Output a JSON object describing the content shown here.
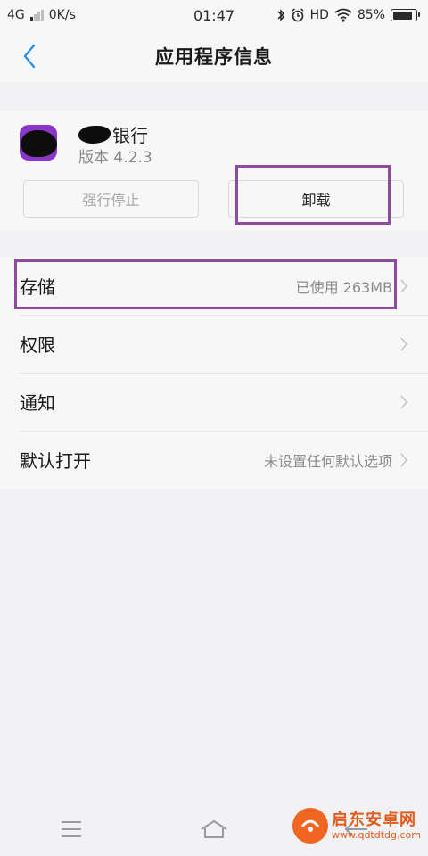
{
  "status_bar": {
    "network": "4G",
    "speed": "0K/s",
    "time": "01:47",
    "hd": "HD",
    "battery_text": "85%",
    "battery_level": 0.85
  },
  "nav": {
    "title": "应用程序信息",
    "back_icon": "chevron-left-icon"
  },
  "app": {
    "name_suffix": "银行",
    "version": "版本 4.2.3",
    "force_stop_label": "强行停止",
    "uninstall_label": "卸载"
  },
  "settings": {
    "items": [
      {
        "label": "存储",
        "value": "已使用 263MB"
      },
      {
        "label": "权限",
        "value": ""
      },
      {
        "label": "通知",
        "value": ""
      },
      {
        "label": "默认打开",
        "value": "未设置任何默认选项"
      }
    ]
  },
  "watermark": {
    "name": "启东安卓网",
    "url": "www.qdtdtdg.com"
  },
  "colors": {
    "accent_blue": "#2c8fe4",
    "highlight": "#8e4c9e",
    "watermark": "#f0651f"
  }
}
